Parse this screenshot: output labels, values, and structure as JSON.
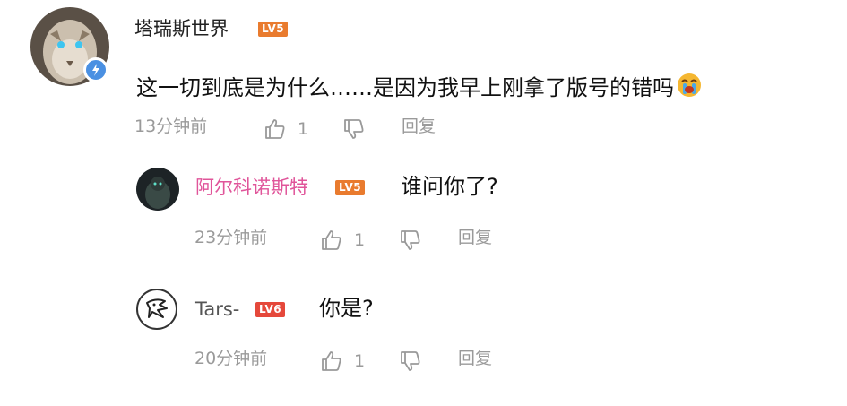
{
  "comments": [
    {
      "username": "塔瑞斯世界",
      "level": "LV5",
      "text": "这一切到底是为什么……是因为我早上刚拿了版号的错吗",
      "emoji": "crying-face-icon",
      "time": "13分钟前",
      "likes": "1",
      "reply_label": "回复",
      "verified": true,
      "username_color": "#333333"
    },
    {
      "username": "阿尔科诺斯特",
      "level": "LV5",
      "text": "谁问你了?",
      "time": "23分钟前",
      "likes": "1",
      "reply_label": "回复",
      "username_color": "#e0559a"
    },
    {
      "username": "Tars-",
      "level": "LV6",
      "text": "你是?",
      "time": "20分钟前",
      "likes": "1",
      "reply_label": "回复",
      "username_color": "#555555"
    }
  ],
  "colors": {
    "level_badge_orange": "#e97b2e",
    "level_badge_red": "#e5483b",
    "verified_blue": "#4a90e2",
    "meta_gray": "#9a9a9a"
  }
}
